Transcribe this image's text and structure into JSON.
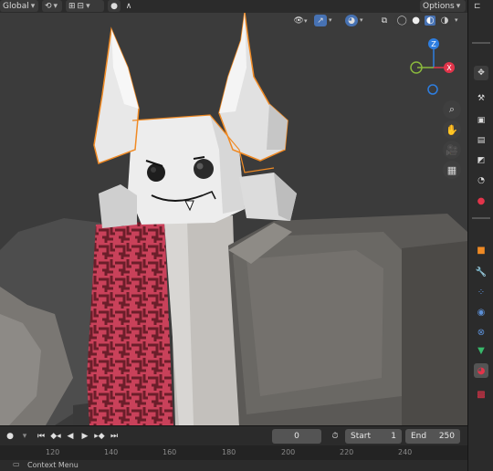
{
  "header": {
    "transform_orientation": "Global",
    "options_label": "Options"
  },
  "timeline": {
    "current_frame": "0",
    "start_label": "Start",
    "start_value": "1",
    "end_label": "End",
    "end_value": "250",
    "ruler_ticks": [
      "120",
      "140",
      "160",
      "180",
      "200",
      "220",
      "240"
    ]
  },
  "status": {
    "context_menu_label": "Context Menu"
  },
  "colors": {
    "selection_outline": "#f08a24",
    "gizmo_x": "#e2344a",
    "gizmo_y": "#8ab83d",
    "gizmo_z": "#2e7ee0",
    "active_blue": "#4772b3"
  },
  "icons": {
    "viewport_tools": [
      "zoom-icon",
      "hand-icon",
      "camera-icon",
      "grid-icon"
    ],
    "properties_tabs": [
      "tool-icon",
      "render-icon",
      "output-icon",
      "view-layer-icon",
      "scene-icon",
      "world-icon",
      "object-icon",
      "modifier-icon",
      "particles-icon",
      "physics-icon",
      "constraints-icon",
      "data-icon",
      "material-icon",
      "texture-icon"
    ]
  }
}
